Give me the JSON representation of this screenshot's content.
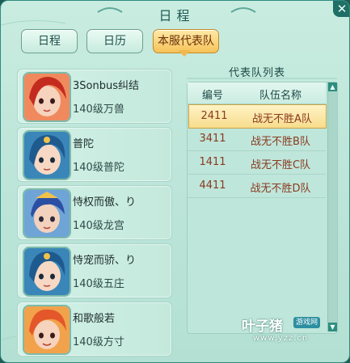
{
  "window": {
    "title": "日程",
    "close_label": "✕"
  },
  "tabs": [
    {
      "label": "日程",
      "active": false
    },
    {
      "label": "日历",
      "active": false
    },
    {
      "label": "本服代表队",
      "active": true
    }
  ],
  "members": [
    {
      "name": "3Sonbus纠结",
      "level": "140级万兽",
      "avatar": "red-haired-girl-avatar"
    },
    {
      "name": "普陀",
      "level": "140级普陀",
      "avatar": "blue-haired-girl-avatar"
    },
    {
      "name": "恃权而傲、り",
      "level": "140级龙宫",
      "avatar": "blue-haired-boy-avatar"
    },
    {
      "name": "恃宠而骄、り",
      "level": "140级五庄",
      "avatar": "blue-haired-girl-avatar"
    },
    {
      "name": "和歌般若",
      "level": "140级方寸",
      "avatar": "orange-haired-boy-avatar"
    }
  ],
  "team_list": {
    "title": "代表队列表",
    "columns": [
      "编号",
      "队伍名称"
    ],
    "rows": [
      {
        "id": "2411",
        "name": "战无不胜A队",
        "selected": true
      },
      {
        "id": "3411",
        "name": "战无不胜B队",
        "selected": false
      },
      {
        "id": "1411",
        "name": "战无不胜C队",
        "selected": false
      },
      {
        "id": "4411",
        "name": "战无不胜D队",
        "selected": false
      }
    ]
  },
  "watermark": {
    "main": "叶子猪",
    "badge": "游戏网",
    "url": "www.yzz.cn"
  },
  "colors": {
    "accent_active_tab": "#f6c35a",
    "panel_bg": "#bfe6da",
    "row_text": "#8a3a21"
  }
}
